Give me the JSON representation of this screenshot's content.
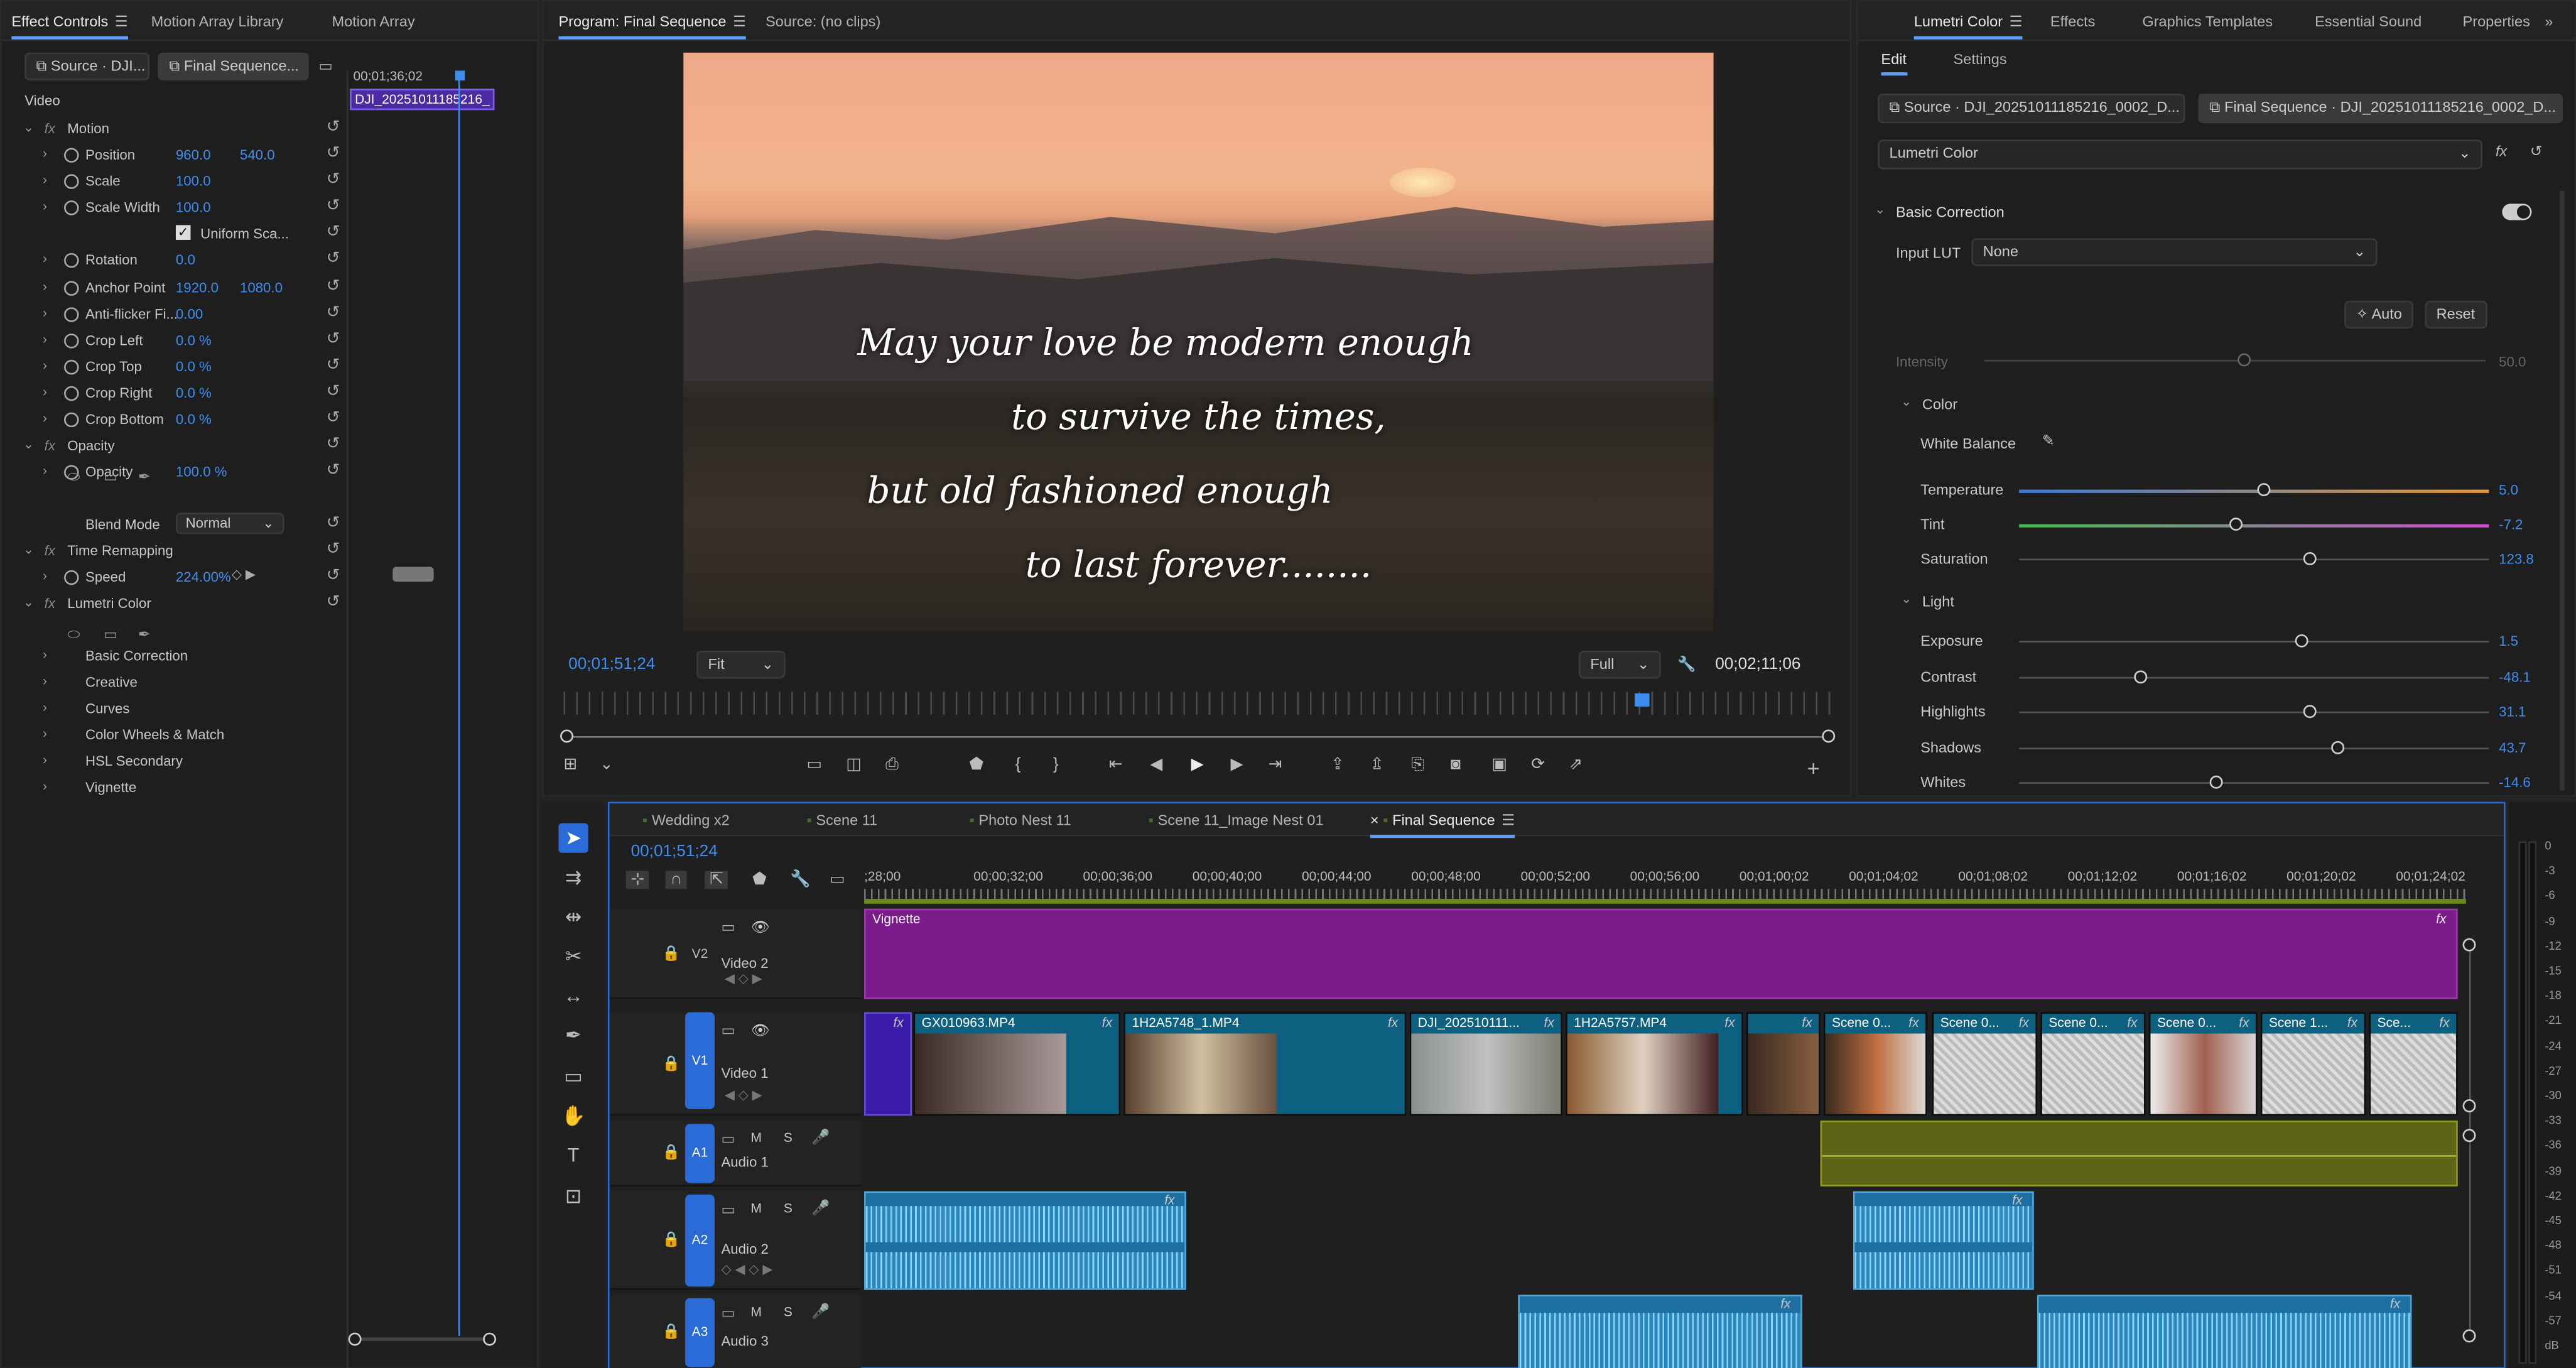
{
  "effect_controls": {
    "tabs": [
      "Effect Controls",
      "Motion Array Library",
      "Motion Array"
    ],
    "source_tab": "Source · DJI...",
    "seq_tab": "Final Sequence...",
    "timecode": "00;01;36;02",
    "clip_label": "DJI_20251011185216_",
    "video_label": "Video",
    "rows": [
      {
        "label": "Motion",
        "v1": "",
        "v2": ""
      },
      {
        "label": "Position",
        "v1": "960.0",
        "v2": "540.0"
      },
      {
        "label": "Scale",
        "v1": "100.0",
        "v2": ""
      },
      {
        "label": "Scale Width",
        "v1": "100.0",
        "v2": ""
      },
      {
        "label": "Uniform Sca...",
        "v1": "",
        "v2": ""
      },
      {
        "label": "Rotation",
        "v1": "0.0",
        "v2": ""
      },
      {
        "label": "Anchor Point",
        "v1": "1920.0",
        "v2": "1080.0"
      },
      {
        "label": "Anti-flicker Fi...",
        "v1": "0.00",
        "v2": ""
      },
      {
        "label": "Crop Left",
        "v1": "0.0 %",
        "v2": ""
      },
      {
        "label": "Crop Top",
        "v1": "0.0 %",
        "v2": ""
      },
      {
        "label": "Crop Right",
        "v1": "0.0 %",
        "v2": ""
      },
      {
        "label": "Crop Bottom",
        "v1": "0.0 %",
        "v2": ""
      },
      {
        "label": "Opacity",
        "v1": "",
        "v2": ""
      },
      {
        "label": "Opacity",
        "v1": "100.0 %",
        "v2": ""
      },
      {
        "label": "Blend Mode",
        "v1": "Normal",
        "v2": ""
      },
      {
        "label": "Time Remapping",
        "v1": "",
        "v2": ""
      },
      {
        "label": "Speed",
        "v1": "224.00%",
        "v2": ""
      },
      {
        "label": "Lumetri Color",
        "v1": "",
        "v2": ""
      },
      {
        "label": "Basic Correction",
        "v1": "",
        "v2": ""
      },
      {
        "label": "Creative",
        "v1": "",
        "v2": ""
      },
      {
        "label": "Curves",
        "v1": "",
        "v2": ""
      },
      {
        "label": "Color Wheels & Match",
        "v1": "",
        "v2": ""
      },
      {
        "label": "HSL Secondary",
        "v1": "",
        "v2": ""
      },
      {
        "label": "Vignette",
        "v1": "",
        "v2": ""
      }
    ]
  },
  "program": {
    "tabs": [
      "Program: Final Sequence",
      "Source: (no clips)"
    ],
    "quote": [
      "May your love be modern enough",
      "to survive the times,",
      "but old fashioned enough",
      "to last forever........"
    ],
    "current_tc": "00;01;51;24",
    "fit": "Fit",
    "quality": "Full",
    "duration_tc": "00;02;11;06"
  },
  "lumetri": {
    "tabs": [
      "Lumetri Color",
      "Effects",
      "Graphics Templates",
      "Essential Sound",
      "Properties"
    ],
    "subtabs": [
      "Edit",
      "Settings"
    ],
    "source": "Source · DJI_20251011185216_0002_D...",
    "seq": "Final Sequence · DJI_20251011185216_0002_D...",
    "effect": "Lumetri Color",
    "basic_correction": "Basic Correction",
    "input_lut_label": "Input LUT",
    "input_lut": "None",
    "auto": "Auto",
    "reset": "Reset",
    "intensity_label": "Intensity",
    "intensity": "50.0",
    "color_label": "Color",
    "white_balance": "White Balance",
    "sliders": [
      {
        "label": "Temperature",
        "value": "5.0",
        "pos": 0.52
      },
      {
        "label": "Tint",
        "value": "-7.2",
        "pos": 0.46
      },
      {
        "label": "Saturation",
        "value": "123.8",
        "pos": 0.62
      }
    ],
    "light_label": "Light",
    "light": [
      {
        "label": "Exposure",
        "value": "1.5",
        "pos": 0.6
      },
      {
        "label": "Contrast",
        "value": "-48.1",
        "pos": 0.26
      },
      {
        "label": "Highlights",
        "value": "31.1",
        "pos": 0.62
      },
      {
        "label": "Shadows",
        "value": "43.7",
        "pos": 0.68
      },
      {
        "label": "Whites",
        "value": "-14.6",
        "pos": 0.42
      }
    ]
  },
  "timeline": {
    "tabs": [
      "Wedding x2",
      "Scene 11",
      "Photo Nest 11",
      "Scene 11_Image Nest 01",
      "Final Sequence"
    ],
    "timecode": "00;01;51;24",
    "ruler": [
      ";28;00",
      "00;00;32;00",
      "00;00;36;00",
      "00;00;40;00",
      "00;00;44;00",
      "00;00;48;00",
      "00;00;52;00",
      "00;00;56;00",
      "00;01;00;02",
      "00;01;04;02",
      "00;01;08;02",
      "00;01;12;02",
      "00;01;16;02",
      "00;01;20;02",
      "00;01;24;02"
    ],
    "tracks": [
      {
        "badge": "V2",
        "name": "Video 2"
      },
      {
        "badge": "V1",
        "name": "Video 1"
      },
      {
        "badge": "A1",
        "name": "Audio 1"
      },
      {
        "badge": "A2",
        "name": "Audio 2"
      },
      {
        "badge": "A3",
        "name": "Audio 3"
      }
    ],
    "vignette": "Vignette",
    "clips": [
      "GX010963.MP4",
      "1H2A5748_1.MP4",
      "DJI_202510111...",
      "1H2A5757.MP4",
      "Scene 0...",
      "Scene 0...",
      "Scene 0...",
      "Scene 0...",
      "Scene 1...",
      "Sce..."
    ],
    "meter": [
      "0",
      "-3",
      "-6",
      "-9",
      "-12",
      "-15",
      "-18",
      "-21",
      "-24",
      "-27",
      "-30",
      "-33",
      "-36",
      "-39",
      "-42",
      "-45",
      "-48",
      "-51",
      "-54",
      "-57",
      "dB"
    ],
    "m": "M",
    "s": "S"
  }
}
